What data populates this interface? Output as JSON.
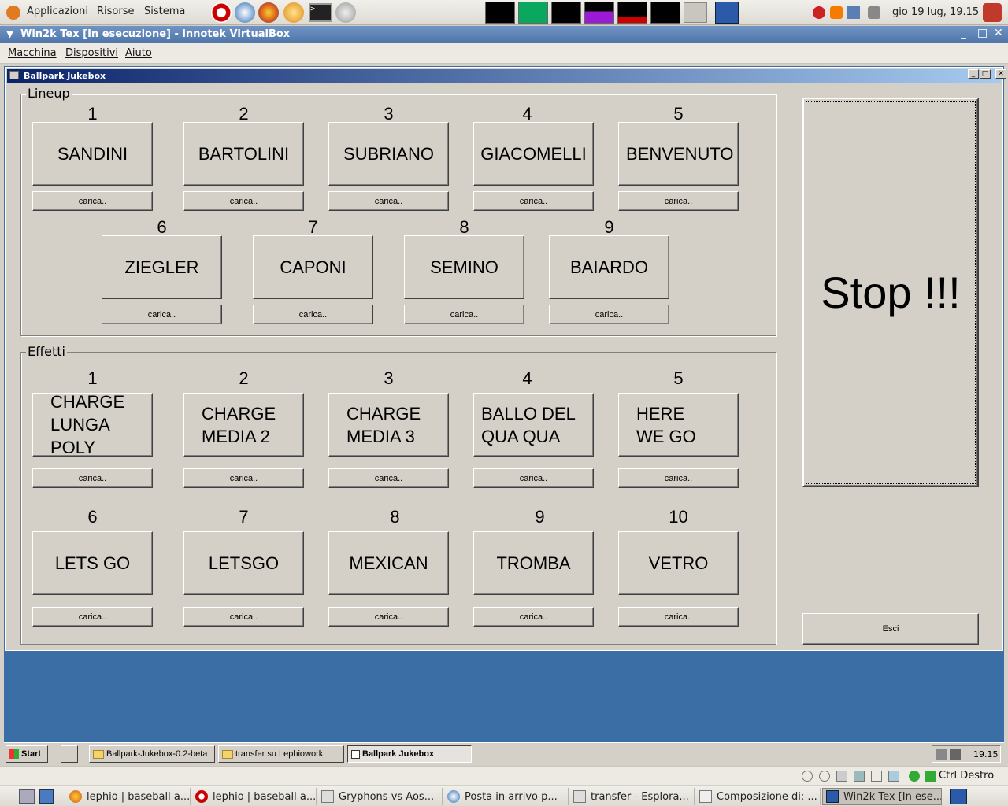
{
  "top_panel": {
    "menus": [
      "Applicazioni",
      "Risorse",
      "Sistema"
    ],
    "clock": "gio 19 lug, 19.15"
  },
  "vbox": {
    "title": "Win2k Tex [In esecuzione] - innotek VirtualBox",
    "menus": [
      "Macchina",
      "Dispositivi",
      "Aiuto"
    ],
    "host_key": "Ctrl Destro"
  },
  "app": {
    "title": "Ballpark Jukebox",
    "lineup": {
      "label": "Lineup",
      "row1": [
        {
          "num": "1",
          "name": "SANDINI",
          "load": "carica.."
        },
        {
          "num": "2",
          "name": "BARTOLINI",
          "load": "carica.."
        },
        {
          "num": "3",
          "name": "SUBRIANO",
          "load": "carica.."
        },
        {
          "num": "4",
          "name": "GIACOMELLI",
          "load": "carica.."
        },
        {
          "num": "5",
          "name": "BENVENUTO",
          "load": "carica.."
        }
      ],
      "row2": [
        {
          "num": "6",
          "name": "ZIEGLER",
          "load": "carica.."
        },
        {
          "num": "7",
          "name": "CAPONI",
          "load": "carica.."
        },
        {
          "num": "8",
          "name": "SEMINO",
          "load": "carica.."
        },
        {
          "num": "9",
          "name": "BAIARDO",
          "load": "carica.."
        }
      ]
    },
    "effects": {
      "label": "Effetti",
      "row1": [
        {
          "num": "1",
          "name": "CHARGE LUNGA POLY",
          "load": "carica.."
        },
        {
          "num": "2",
          "name": "CHARGE MEDIA 2",
          "load": "carica.."
        },
        {
          "num": "3",
          "name": "CHARGE MEDIA 3",
          "load": "carica.."
        },
        {
          "num": "4",
          "name": "BALLO DEL QUA QUA",
          "load": "carica.."
        },
        {
          "num": "5",
          "name": "HERE WE GO",
          "load": "carica.."
        }
      ],
      "row2": [
        {
          "num": "6",
          "name": "LETS GO",
          "load": "carica.."
        },
        {
          "num": "7",
          "name": "LETSGO",
          "load": "carica.."
        },
        {
          "num": "8",
          "name": "MEXICAN",
          "load": "carica.."
        },
        {
          "num": "9",
          "name": "TROMBA",
          "load": "carica.."
        },
        {
          "num": "10",
          "name": "VETRO",
          "load": "carica.."
        }
      ]
    },
    "stop_label": "Stop !!!",
    "exit_label": "Esci"
  },
  "guest_taskbar": {
    "start": "Start",
    "tasks": [
      "Ballpark-Jukebox-0.2-beta",
      "transfer su Lephiowork",
      "Ballpark Jukebox"
    ],
    "clock": "19.15"
  },
  "bottom_tasks": [
    "lephio | baseball a...",
    "lephio | baseball a...",
    "Gryphons vs Aos...",
    "Posta in arrivo p...",
    "transfer - Esplora...",
    "Composizione di: ...",
    "Win2k Tex [In ese..."
  ],
  "colors": {
    "desktop": "#3a6ea5",
    "win_face": "#d4d0c8",
    "active_title": "#0a246a"
  }
}
